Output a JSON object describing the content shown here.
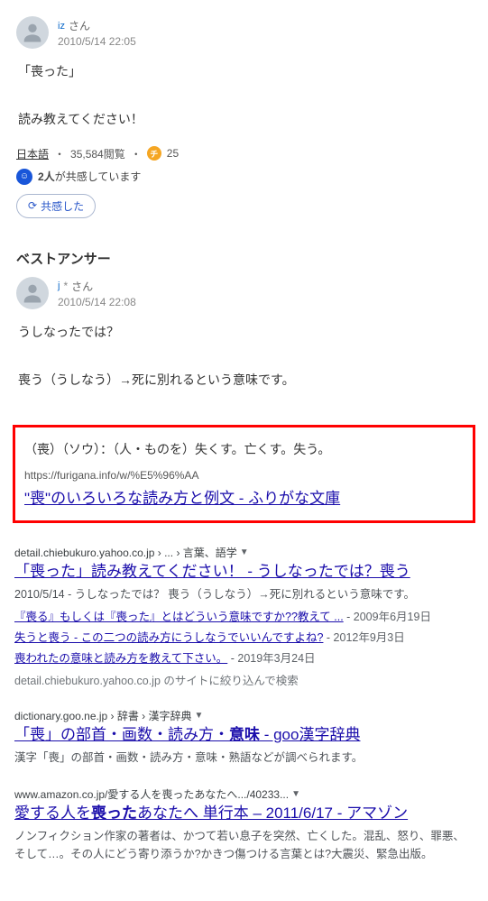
{
  "question": {
    "user_id_prefix": "iz",
    "user_suffix": "さん",
    "timestamp": "2010/5/14 22:05",
    "body_line1": "「喪った」",
    "body_line2": "読み教えてください！",
    "category": "日本語",
    "views": "35,584閲覧",
    "coin_icon": "チ",
    "coins": "25",
    "sympathizers_count": "2人",
    "sympathizers_text": "が共感しています",
    "share_label": "共感した"
  },
  "best_answer": {
    "title": "ベストアンサー",
    "user_id_prefix": "j",
    "user_id_censored": "*",
    "user_suffix": "さん",
    "timestamp": "2010/5/14 22:08",
    "body_line1": "うしなったでは？",
    "body_line2": "喪う（うしなう）→死に別れるという意味です。"
  },
  "red_box": {
    "definition": "（喪）（ソウ）：（人・ものを）失くす。亡くす。失う。",
    "url": "https://furigana.info/w/%E5%96%AA",
    "link_text": "\"喪\"のいろいろな読み方と例文 - ふりがな文庫"
  },
  "results": [
    {
      "breadcrumb": "detail.chiebukuro.yahoo.co.jp › ... › 言葉、語学",
      "title": "「喪った」読み教えてください！ - うしなったでは？喪う",
      "snippet": "2010/5/14 - うしなったでは？ 喪う（うしなう）→死に別れるという意味です。",
      "sublinks": [
        {
          "text": "『喪る』もしくは『喪った』とはどういう意味ですか??教えて ...",
          "date": "2009年6月19日"
        },
        {
          "text": "失うと喪う - この二つの読み方にうしなうでいいんですよね?",
          "date": "2012年9月3日"
        },
        {
          "text": "喪われたの意味と読み方を教えて下さい。",
          "date": "2019年3月24日"
        }
      ],
      "more_from": "detail.chiebukuro.yahoo.co.jp のサイトに絞り込んで検索"
    },
    {
      "breadcrumb": "dictionary.goo.ne.jp › 辞書 › 漢字辞典",
      "title_pre": "「喪」の部首・画数・読み方・",
      "title_bold": "意味",
      "title_post": " - goo漢字辞典",
      "snippet": "漢字「喪」の部首・画数・読み方・意味・熟語などが調べられます。"
    },
    {
      "breadcrumb": "www.amazon.co.jp/愛する人を喪ったあなたへ.../40233...",
      "title_pre": "愛する人を",
      "title_bold": "喪った",
      "title_post": "あなたへ 単行本 – 2011/6/17 - アマゾン",
      "snippet": "ノンフィクション作家の著者は、かつて若い息子を突然、亡くした。混乱、怒り、罪悪、そして…。その人にどう寄り添うか?かきつ傷つける言葉とは?大震災、緊急出版。"
    }
  ]
}
